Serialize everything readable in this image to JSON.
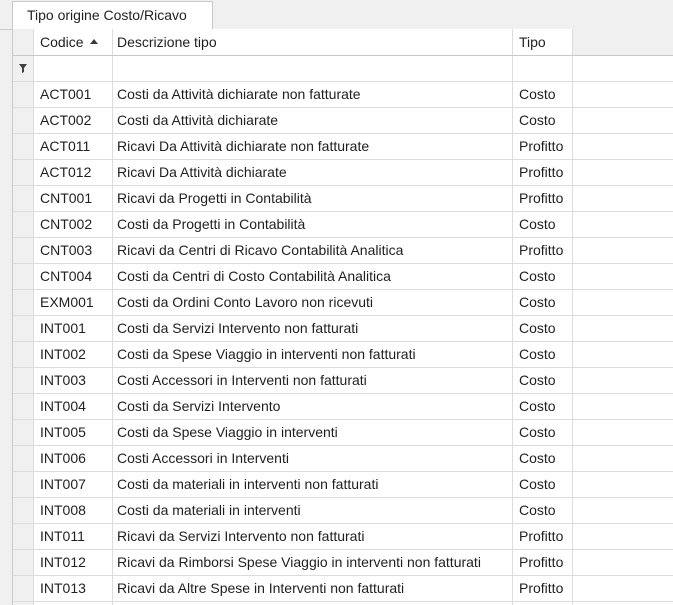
{
  "tab": {
    "label": "Tipo origine Costo/Ricavo"
  },
  "columns": {
    "code": "Codice",
    "description": "Descrizione tipo",
    "type": "Tipo"
  },
  "filter_icon": "filter-icon",
  "sort": {
    "column": "Codice",
    "direction": "ascending"
  },
  "rows": [
    {
      "code": "ACT001",
      "description": "Costi da Attività dichiarate non fatturate",
      "type": "Costo"
    },
    {
      "code": "ACT002",
      "description": "Costi da Attività dichiarate",
      "type": "Costo"
    },
    {
      "code": "ACT011",
      "description": "Ricavi Da Attività dichiarate non fatturate",
      "type": "Profitto"
    },
    {
      "code": "ACT012",
      "description": "Ricavi Da Attività dichiarate",
      "type": "Profitto"
    },
    {
      "code": "CNT001",
      "description": "Ricavi da Progetti in Contabilità",
      "type": "Profitto"
    },
    {
      "code": "CNT002",
      "description": "Costi da Progetti in Contabilità",
      "type": "Costo"
    },
    {
      "code": "CNT003",
      "description": "Ricavi da Centri di Ricavo Contabilità Analitica",
      "type": "Profitto"
    },
    {
      "code": "CNT004",
      "description": "Costi da Centri di Costo Contabilità Analitica",
      "type": "Costo"
    },
    {
      "code": "EXM001",
      "description": "Costi da Ordini Conto Lavoro non ricevuti",
      "type": "Costo"
    },
    {
      "code": "INT001",
      "description": "Costi da Servizi Intervento non fatturati",
      "type": "Costo"
    },
    {
      "code": "INT002",
      "description": "Costi da Spese Viaggio in interventi non fatturati",
      "type": "Costo"
    },
    {
      "code": "INT003",
      "description": "Costi Accessori in Interventi non fatturati",
      "type": "Costo"
    },
    {
      "code": "INT004",
      "description": "Costi da Servizi Intervento",
      "type": "Costo"
    },
    {
      "code": "INT005",
      "description": "Costi da Spese Viaggio in interventi",
      "type": "Costo"
    },
    {
      "code": "INT006",
      "description": "Costi Accessori in Interventi",
      "type": "Costo"
    },
    {
      "code": "INT007",
      "description": "Costi da materiali in interventi non fatturati",
      "type": "Costo"
    },
    {
      "code": "INT008",
      "description": "Costi da materiali in interventi",
      "type": "Costo"
    },
    {
      "code": "INT011",
      "description": "Ricavi da Servizi Intervento non fatturati",
      "type": "Profitto"
    },
    {
      "code": "INT012",
      "description": "Ricavi da Rimborsi Spese Viaggio in interventi non fatturati",
      "type": "Profitto"
    },
    {
      "code": "INT013",
      "description": "Ricavi da Altre Spese in Interventi non fatturati",
      "type": "Profitto"
    },
    {
      "code": "",
      "description": "",
      "type": ""
    }
  ]
}
